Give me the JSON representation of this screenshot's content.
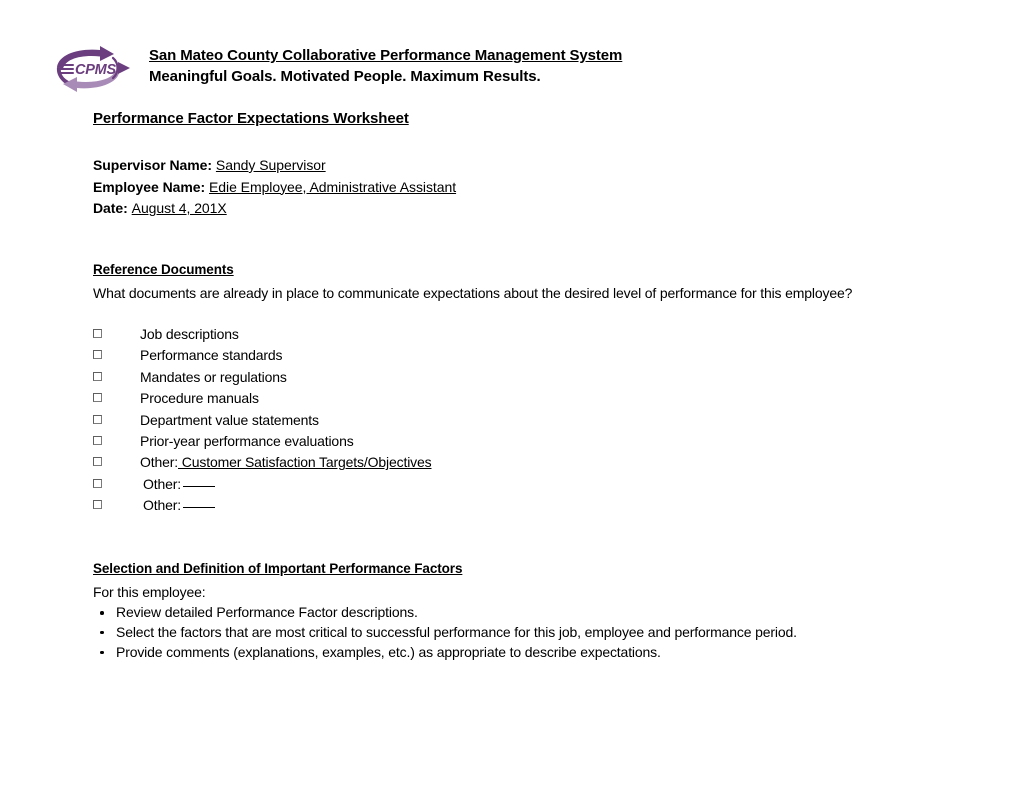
{
  "header": {
    "logo_alt": "CPMS logo",
    "logo_text": "CPMS",
    "logo_color_dark": "#6B3E7F",
    "logo_color_light": "#A98BB8",
    "org_title": "San Mateo County Collaborative Performance Management System",
    "org_tagline": "Meaningful Goals.  Motivated People.  Maximum Results."
  },
  "worksheet": {
    "title": "Performance Factor Expectations Worksheet"
  },
  "meta": {
    "supervisor_label": "Supervisor Name:",
    "supervisor_value": "Sandy Supervisor",
    "employee_label": "Employee Name:",
    "employee_value": "Edie Employee, Administrative Assistant",
    "date_label": "Date:",
    "date_value": "August 4, 201X"
  },
  "reference_documents": {
    "heading": "Reference Documents",
    "question": "What documents are already in place to communicate expectations about the desired level of performance for this employee?",
    "items": [
      {
        "label": "Job descriptions",
        "checked": false,
        "value": "",
        "blank": false,
        "indented": false
      },
      {
        "label": "Performance standards",
        "checked": false,
        "value": "",
        "blank": false,
        "indented": false
      },
      {
        "label": "Mandates or regulations",
        "checked": false,
        "value": "",
        "blank": false,
        "indented": false
      },
      {
        "label": "Procedure manuals",
        "checked": false,
        "value": "",
        "blank": false,
        "indented": false
      },
      {
        "label": "Department value statements",
        "checked": false,
        "value": "",
        "blank": false,
        "indented": false
      },
      {
        "label": "Prior-year performance evaluations",
        "checked": false,
        "value": "",
        "blank": false,
        "indented": false
      },
      {
        "label": "Other:",
        "checked": false,
        "value": "Customer Satisfaction Targets/Objectives",
        "blank": false,
        "indented": false
      },
      {
        "label": "Other:",
        "checked": false,
        "value": "",
        "blank": true,
        "indented": true
      },
      {
        "label": "Other:",
        "checked": false,
        "value": "",
        "blank": true,
        "indented": true
      }
    ]
  },
  "selection_section": {
    "heading": "Selection and Definition of Important Performance Factors",
    "intro": "For this employee:",
    "bullets": [
      "Review detailed Performance Factor descriptions.",
      "Select the factors that are most critical to successful performance for this job, employee and performance period.",
      "Provide comments (explanations, examples, etc.) as appropriate to describe expectations."
    ]
  }
}
